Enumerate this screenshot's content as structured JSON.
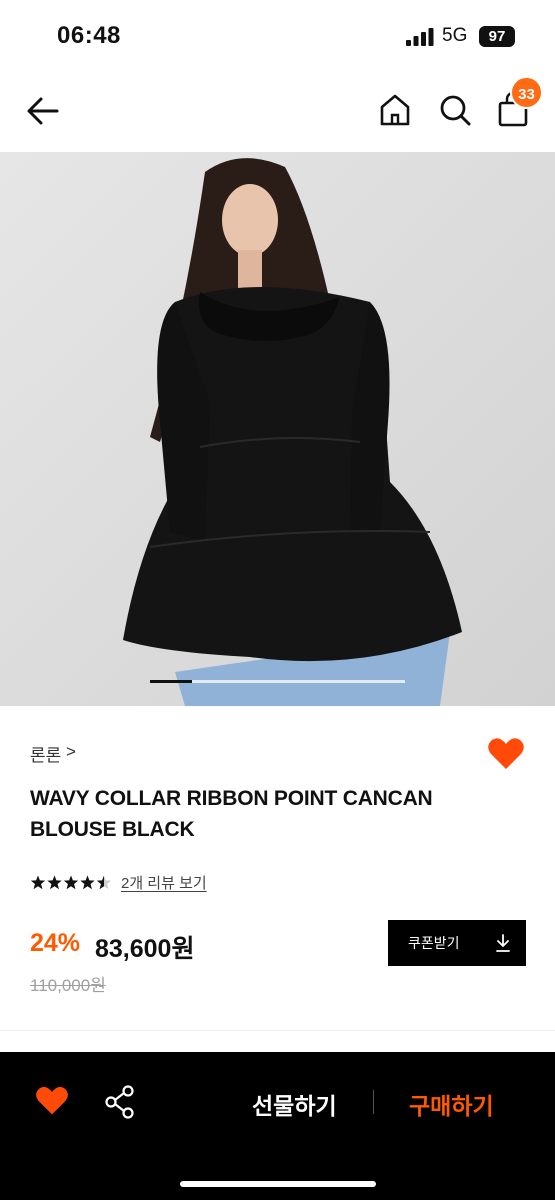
{
  "status": {
    "time": "06:48",
    "network": "5G",
    "battery": "97"
  },
  "nav": {
    "cart_count": "33",
    "icons": [
      "back-arrow-icon",
      "home-icon",
      "search-icon",
      "shopping-bag-icon"
    ]
  },
  "product": {
    "brand": "론론",
    "brand_chevron": ">",
    "title": "WAVY COLLAR RIBBON POINT CANCAN BLOUSE BLACK",
    "rating": 4.5,
    "rating_max": 5,
    "review_link": "2개 리뷰 보기",
    "discount": "24%",
    "price": "83,600원",
    "original_price": "110,000원",
    "coupon_label": "쿠폰받기",
    "wishlisted": true,
    "image_index": 1
  },
  "bottom": {
    "gift_label": "선물하기",
    "buy_label": "구매하기"
  },
  "colors": {
    "accent": "#ff5a00",
    "badge": "#ff6a13",
    "heart": "#ff4a0a"
  }
}
